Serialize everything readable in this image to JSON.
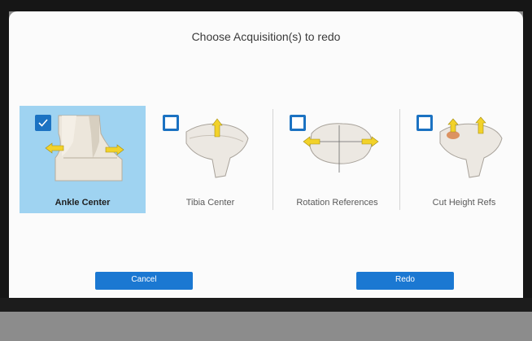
{
  "dialog": {
    "title": "Choose Acquisition(s) to redo"
  },
  "options": [
    {
      "label": "Ankle Center",
      "checked": true
    },
    {
      "label": "Tibia Center",
      "checked": false
    },
    {
      "label": "Rotation References",
      "checked": false
    },
    {
      "label": "Cut Height Refs",
      "checked": false
    }
  ],
  "buttons": {
    "cancel_label": "Cancel",
    "redo_label": "Redo"
  },
  "colors": {
    "accent": "#1b78d2",
    "selected_background": "#9fd3f1",
    "bone": "#e9e4dc",
    "arrow": "#f2d22a"
  }
}
